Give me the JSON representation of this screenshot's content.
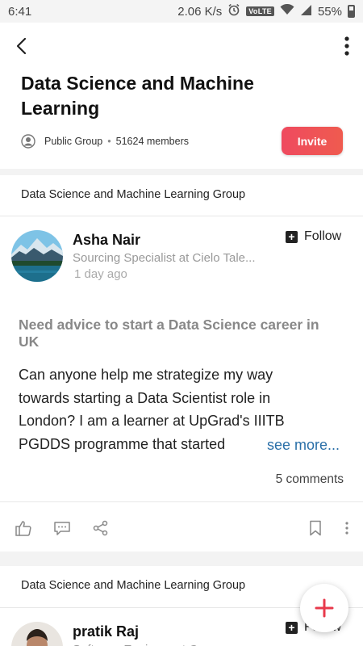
{
  "status_bar": {
    "time": "6:41",
    "network_speed": "2.06 K/s",
    "volte": "VoLTE",
    "battery": "55%",
    "icons": [
      "alarm-icon",
      "wifi-icon",
      "signal-icon",
      "battery-icon"
    ]
  },
  "header": {
    "title": "Data Science and Machine Learning",
    "group_type": "Public Group",
    "separator": "•",
    "members": "51624 members",
    "invite_label": "Invite"
  },
  "colors": {
    "accent": "#ef4a5f",
    "link": "#2a6fa8"
  },
  "posts": [
    {
      "group_label": "Data Science and Machine Learning Group",
      "author": "Asha Nair",
      "role": "Sourcing Specialist at Cielo Tale...",
      "time": "1 day ago",
      "follow_label": "Follow",
      "title": "Need advice to start a Data Science career in UK",
      "body": "Can anyone help me strategize my way towards starting a Data Scientist role in London? I am a learner at UpGrad's IIITB PGDDS programme that started",
      "see_more": "see more...",
      "comments": "5 comments"
    },
    {
      "group_label": "Data Science and Machine Learning Group",
      "author": "pratik Raj",
      "role": "Software Engineer at C...",
      "follow_label": "Follow"
    }
  ]
}
